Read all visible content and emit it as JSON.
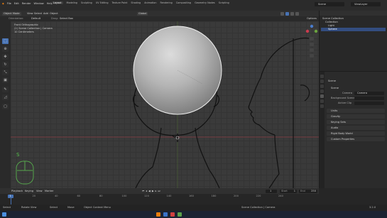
{
  "menus": [
    "File",
    "Edit",
    "Render",
    "Window",
    "Help"
  ],
  "workspaces": [
    "Layout",
    "Modeling",
    "Sculpting",
    "UV Editing",
    "Texture Paint",
    "Shading",
    "Animation",
    "Rendering",
    "Compositing",
    "Geometry Nodes",
    "Scripting"
  ],
  "active_workspace": "Layout",
  "scene_label": "Scene",
  "view_layer_label": "ViewLayer",
  "viewport": {
    "mode": "Object Mode",
    "view_menus": [
      "View",
      "Select",
      "Add",
      "Object"
    ],
    "orientation": "Global",
    "orientation_label": "Orientation:",
    "orientation_value": "Default",
    "drag_label": "Drag:",
    "drag_value": "Select Box",
    "options": "Options",
    "overlay_lines": [
      "Front Orthographic",
      "(1) Scene Collection | Camera",
      "10 Centimeters"
    ],
    "key_hint": "S"
  },
  "outliner": {
    "items": [
      {
        "label": "Scene Collection",
        "indent": 0
      },
      {
        "label": "Collection",
        "indent": 1
      },
      {
        "label": "Light",
        "indent": 2
      },
      {
        "label": "Sphere",
        "indent": 2,
        "selected": true
      }
    ]
  },
  "properties": {
    "header": "Scene",
    "panel_title": "Scene",
    "camera_label": "Camera",
    "camera_value": "Camera",
    "background_label": "Background Scene",
    "active_clip_label": "Active Clip",
    "sections": [
      "Units",
      "Gravity",
      "Keying Sets",
      "Audio",
      "Rigid Body World",
      "Custom Properties"
    ]
  },
  "timeline": {
    "menus": [
      "Playback",
      "Keying",
      "View",
      "Marker"
    ],
    "ticks": [
      "0",
      "20",
      "40",
      "60",
      "80",
      "100",
      "120",
      "140",
      "160",
      "180",
      "200",
      "220",
      "240"
    ],
    "current_frame": "1",
    "start_label": "Start",
    "start_value": "1",
    "end_label": "End",
    "end_value": "250"
  },
  "statusbar": [
    "Select",
    "Rotate View",
    "Select",
    "Move",
    "Object Context Menu",
    "Scene Collection | Camera"
  ],
  "version": "3.2.0"
}
